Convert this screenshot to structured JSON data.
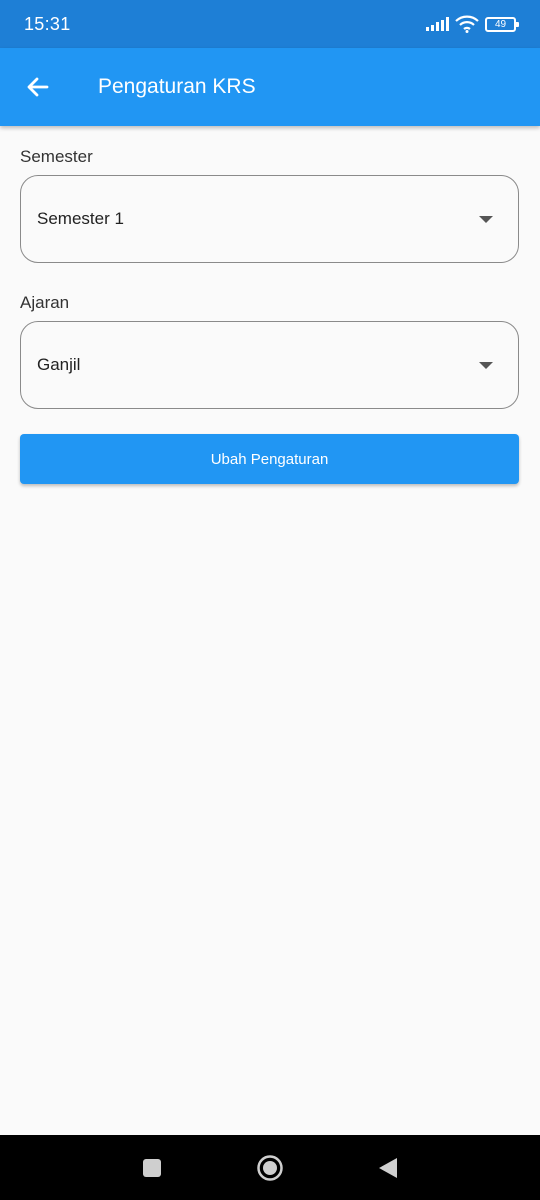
{
  "status_bar": {
    "time": "15:31",
    "battery": "49"
  },
  "app_bar": {
    "title": "Pengaturan KRS",
    "back_icon": "arrow-left-icon"
  },
  "form": {
    "semester": {
      "label": "Semester",
      "value": "Semester 1"
    },
    "ajaran": {
      "label": "Ajaran",
      "value": "Ganjil"
    },
    "submit_label": "Ubah Pengaturan"
  },
  "colors": {
    "primary": "#2196f3",
    "status_bar": "#1e7fd6",
    "background": "#fafafa"
  },
  "nav_bar": {
    "icons": [
      "square-recents-icon",
      "circle-home-icon",
      "triangle-back-icon"
    ]
  }
}
